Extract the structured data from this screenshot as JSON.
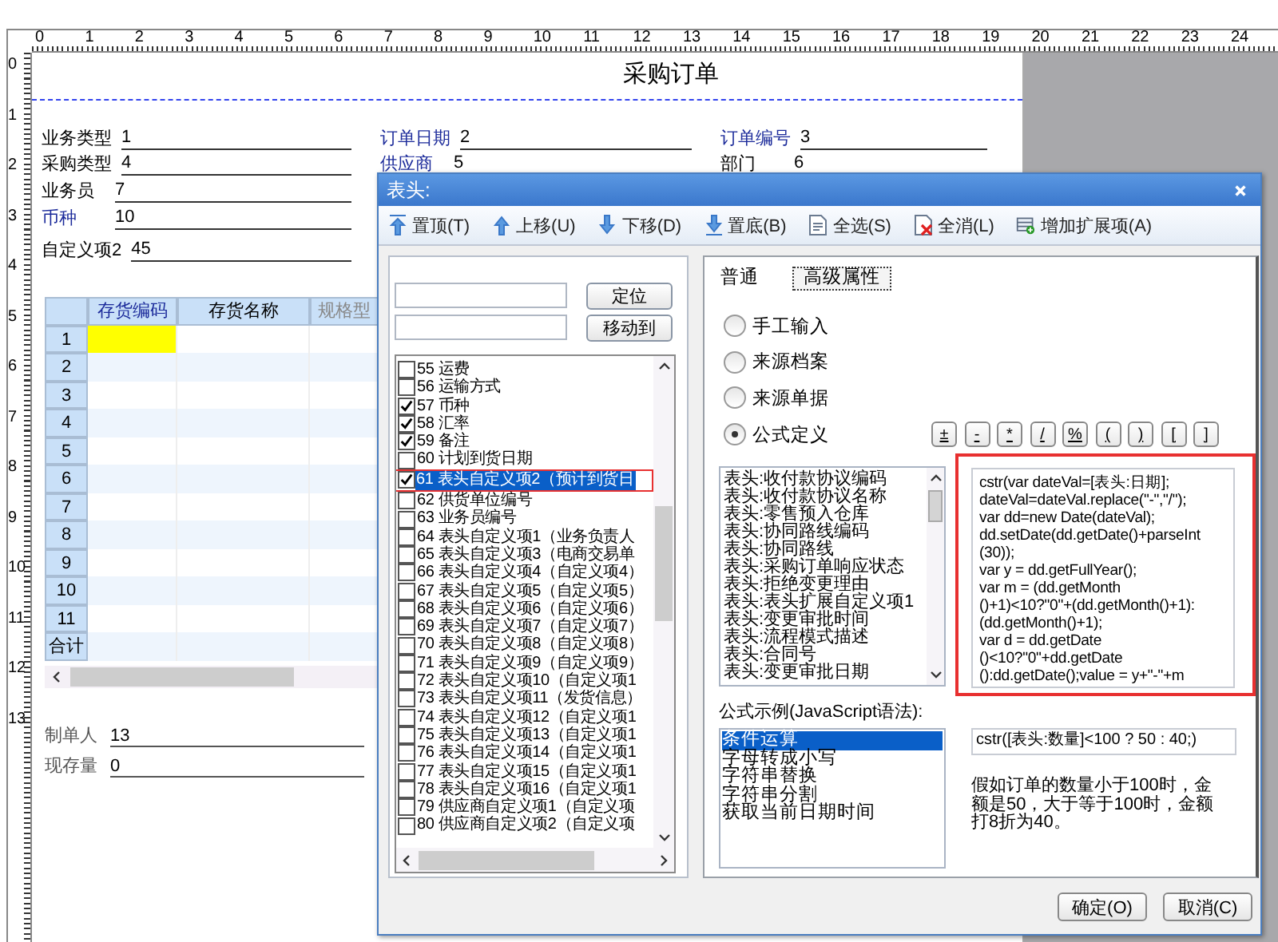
{
  "ruler": {
    "horizontal": [
      "0",
      "1",
      "2",
      "3",
      "4",
      "5",
      "6",
      "7",
      "8",
      "9",
      "10",
      "11",
      "12",
      "13",
      "14",
      "15",
      "16",
      "17",
      "18",
      "19",
      "20",
      "21",
      "22",
      "23",
      "24"
    ],
    "vertical": [
      "0",
      "1",
      "2",
      "3",
      "4",
      "5",
      "6",
      "7",
      "8",
      "9",
      "10",
      "11",
      "12",
      "13"
    ]
  },
  "document": {
    "title": "采购订单",
    "header_fields": [
      [
        {
          "label": "业务类型",
          "value": "1",
          "required": false
        },
        {
          "label": "订单日期",
          "value": "2",
          "required": true
        },
        {
          "label": "订单编号",
          "value": "3",
          "required": true
        }
      ],
      [
        {
          "label": "采购类型",
          "value": "4",
          "required": false
        },
        {
          "label": "供应商",
          "value": "5",
          "required": true
        },
        {
          "label": "部门",
          "value": "6",
          "required": false
        }
      ],
      [
        {
          "label": "业务员",
          "value": "7",
          "required": false
        }
      ],
      [
        {
          "label": "币种",
          "value": "10",
          "required": true
        }
      ],
      [
        {
          "label": "自定义项2",
          "value": "45",
          "required": false
        }
      ]
    ],
    "grid": {
      "columns": [
        {
          "label": "存货编码",
          "selected": true
        },
        {
          "label": "存货名称",
          "selected": false
        },
        {
          "label": "规格型",
          "selected": false
        }
      ],
      "rows": [
        {
          "label": "1",
          "selected": true
        },
        {
          "label": "2",
          "selected": false
        },
        {
          "label": "3",
          "selected": false
        },
        {
          "label": "4",
          "selected": false
        },
        {
          "label": "5",
          "selected": false
        },
        {
          "label": "6",
          "selected": false
        },
        {
          "label": "7",
          "selected": false
        },
        {
          "label": "8",
          "selected": false
        },
        {
          "label": "9",
          "selected": false
        },
        {
          "label": "10",
          "selected": false
        },
        {
          "label": "11",
          "selected": false
        },
        {
          "label": "合计",
          "selected": false
        }
      ]
    },
    "footer_fields": [
      {
        "label": "制单人",
        "value": "13"
      },
      {
        "label": "现存量",
        "value": "0"
      }
    ]
  },
  "dialog": {
    "title": "表头:",
    "toolbar": [
      "置顶(T)",
      "上移(U)",
      "下移(D)",
      "置底(B)",
      "全选(S)",
      "全消(L)",
      "增加扩展项(A)"
    ],
    "locate_button": "定位",
    "move_button": "移动到",
    "items": [
      {
        "label": "55 运费",
        "checked": false,
        "selected": false,
        "highlighted": false
      },
      {
        "label": "56 运输方式",
        "checked": false,
        "selected": false,
        "highlighted": false
      },
      {
        "label": "57 币种",
        "checked": true,
        "selected": false,
        "highlighted": false
      },
      {
        "label": "58 汇率",
        "checked": true,
        "selected": false,
        "highlighted": false
      },
      {
        "label": "59 备注",
        "checked": true,
        "selected": false,
        "highlighted": false
      },
      {
        "label": "60 计划到货日期",
        "checked": false,
        "selected": false,
        "highlighted": false
      },
      {
        "label": "61 表头自定义项2（预计到货日",
        "checked": true,
        "selected": true,
        "highlighted": true
      },
      {
        "label": "62 供货单位编号",
        "checked": false,
        "selected": false,
        "highlighted": false
      },
      {
        "label": "63 业务员编号",
        "checked": false,
        "selected": false,
        "highlighted": false
      },
      {
        "label": "64 表头自定义项1（业务负责人",
        "checked": false,
        "selected": false,
        "highlighted": false
      },
      {
        "label": "65 表头自定义项3（电商交易单",
        "checked": false,
        "selected": false,
        "highlighted": false
      },
      {
        "label": "66 表头自定义项4（自定义项4）",
        "checked": false,
        "selected": false,
        "highlighted": false
      },
      {
        "label": "67 表头自定义项5（自定义项5）",
        "checked": false,
        "selected": false,
        "highlighted": false
      },
      {
        "label": "68 表头自定义项6（自定义项6）",
        "checked": false,
        "selected": false,
        "highlighted": false
      },
      {
        "label": "69 表头自定义项7（自定义项7）",
        "checked": false,
        "selected": false,
        "highlighted": false
      },
      {
        "label": "70 表头自定义项8（自定义项8）",
        "checked": false,
        "selected": false,
        "highlighted": false
      },
      {
        "label": "71 表头自定义项9（自定义项9）",
        "checked": false,
        "selected": false,
        "highlighted": false
      },
      {
        "label": "72 表头自定义项10（自定义项1",
        "checked": false,
        "selected": false,
        "highlighted": false
      },
      {
        "label": "73 表头自定义项11（发货信息）",
        "checked": false,
        "selected": false,
        "highlighted": false
      },
      {
        "label": "74 表头自定义项12（自定义项1",
        "checked": false,
        "selected": false,
        "highlighted": false
      },
      {
        "label": "75 表头自定义项13（自定义项1",
        "checked": false,
        "selected": false,
        "highlighted": false
      },
      {
        "label": "76 表头自定义项14（自定义项1",
        "checked": false,
        "selected": false,
        "highlighted": false
      },
      {
        "label": "77 表头自定义项15（自定义项1",
        "checked": false,
        "selected": false,
        "highlighted": false
      },
      {
        "label": "78 表头自定义项16（自定义项1",
        "checked": false,
        "selected": false,
        "highlighted": false
      },
      {
        "label": "79 供应商自定义项1（自定义项",
        "checked": false,
        "selected": false,
        "highlighted": false
      },
      {
        "label": "80 供应商自定义项2（自定义项",
        "checked": false,
        "selected": false,
        "highlighted": false
      }
    ],
    "tabs": [
      {
        "label": "普通",
        "selected": false
      },
      {
        "label": "高级属性",
        "selected": true
      }
    ],
    "sources": [
      {
        "label": "手工输入",
        "selected": false
      },
      {
        "label": "来源档案",
        "selected": false
      },
      {
        "label": "来源单据",
        "selected": false
      },
      {
        "label": "公式定义",
        "selected": true
      }
    ],
    "operators": [
      "±",
      "-",
      "*",
      "/",
      "%",
      "(",
      ")",
      "[",
      "]"
    ],
    "fields": [
      "表头:收付款协议编码",
      "表头:收付款协议名称",
      "表头:零售预入仓库",
      "表头:协同路线编码",
      "表头:协同路线",
      "表头:采购订单响应状态",
      "表头:拒绝变更理由",
      "表头:表头扩展自定义项1",
      "表头:变更审批时间",
      "表头:流程模式描述",
      "表头:合同号",
      "表头:变更审批日期"
    ],
    "formula": {
      "text": "cstr(var dateVal=[表头:日期];\ndateVal=dateVal.replace(\"-\",\"/\");\nvar dd=new Date(dateVal);\ndd.setDate(dd.getDate()+parseInt\n(30));\nvar y = dd.getFullYear();\nvar m = (dd.getMonth\n()+1)<10?\"0\"+(dd.getMonth()+1):\n(dd.getMonth()+1);\nvar d = dd.getDate\n()<10?\"0\"+dd.getDate\n():dd.getDate();value = y+\"-\"+m",
      "highlighted": true
    },
    "examples_label": "公式示例(JavaScript语法):",
    "examples": [
      {
        "label": "条件运算",
        "selected": true
      },
      {
        "label": "字母转成小写",
        "selected": false
      },
      {
        "label": "字符串替换",
        "selected": false
      },
      {
        "label": "字符串分割",
        "selected": false
      },
      {
        "label": "获取当前日期时间",
        "selected": false
      }
    ],
    "example_formula": "cstr([表头:数量]<100 ? 50 : 40;)",
    "example_description": "假如订单的数量小于100时，金额是50，大于等于100时，金额打8折为40。",
    "buttons": [
      "确定(O)",
      "取消(C)"
    ]
  }
}
